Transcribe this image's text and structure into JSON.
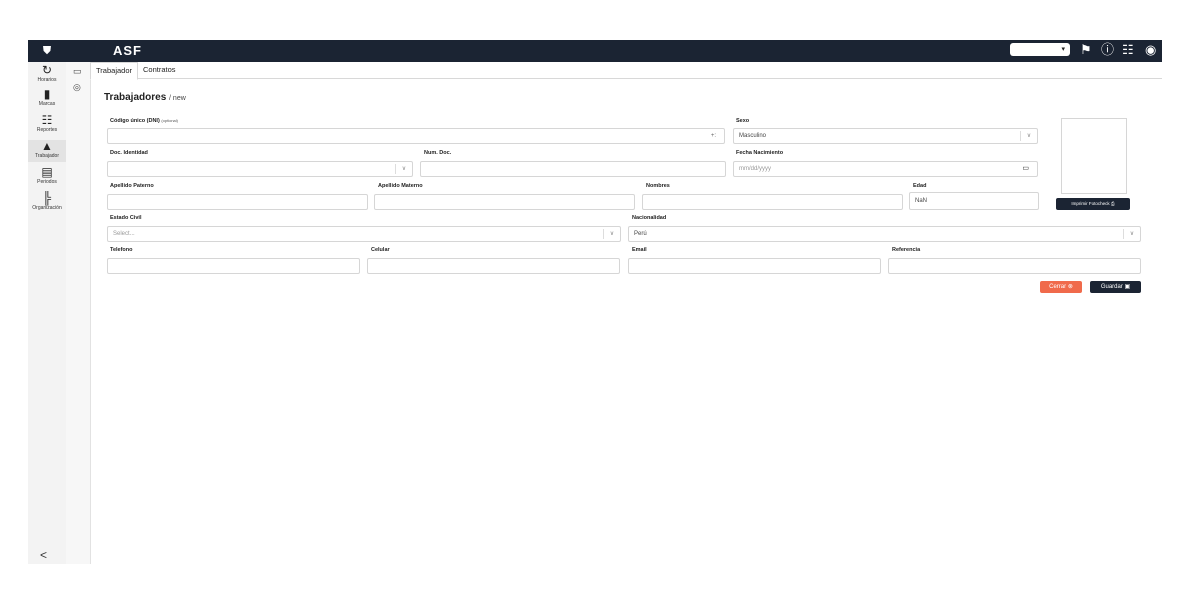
{
  "app": {
    "logo_text": "ASF"
  },
  "sidebar": {
    "items": [
      {
        "label": "Horarios",
        "icon": "clock-plus-icon"
      },
      {
        "label": "Marcas",
        "icon": "bookmark-icon"
      },
      {
        "label": "Reportes",
        "icon": "clipboard-icon"
      },
      {
        "label": "Trabajador",
        "icon": "person-icon",
        "active": true
      },
      {
        "label": "Periodos",
        "icon": "calendar-icon"
      },
      {
        "label": "Organización",
        "icon": "org-chart-icon"
      }
    ],
    "collapse_glyph": "<"
  },
  "topbar": {
    "select_value": ""
  },
  "tabs": [
    {
      "label": "Trabajador",
      "active": true
    },
    {
      "label": "Contratos",
      "active": false
    }
  ],
  "page": {
    "title": "Trabajadores",
    "subtitle": "/ new"
  },
  "form": {
    "dni": {
      "label": "Código único (DNI)",
      "optional": "(optional)",
      "value": "",
      "glyph": "+:"
    },
    "sexo": {
      "label": "Sexo",
      "value": "Masculino"
    },
    "doc_identidad": {
      "label": "Doc. Identidad",
      "value": ""
    },
    "num_doc": {
      "label": "Num. Doc.",
      "value": ""
    },
    "fecha_nacimiento": {
      "label": "Fecha Nacimiento",
      "placeholder": "mm/dd/yyyy"
    },
    "apellido_paterno": {
      "label": "Apellido Paterno",
      "value": ""
    },
    "apellido_materno": {
      "label": "Apellido Materno",
      "value": ""
    },
    "nombres": {
      "label": "Nombres",
      "value": ""
    },
    "edad": {
      "label": "Edad",
      "value": "NaN"
    },
    "estado_civil": {
      "label": "Estado Civil",
      "placeholder": "Select..."
    },
    "nacionalidad": {
      "label": "Nacionalidad",
      "value": "Perú"
    },
    "telefono": {
      "label": "Telefono",
      "value": ""
    },
    "celular": {
      "label": "Celular",
      "value": ""
    },
    "email": {
      "label": "Email",
      "value": ""
    },
    "referencia": {
      "label": "Referencia",
      "value": ""
    }
  },
  "buttons": {
    "print": "Imprimir Fotocheck",
    "cerrar": "Cerrar",
    "guardar": "Guardar"
  },
  "colors": {
    "dark": "#1b2433",
    "danger": "#f06a4b"
  }
}
